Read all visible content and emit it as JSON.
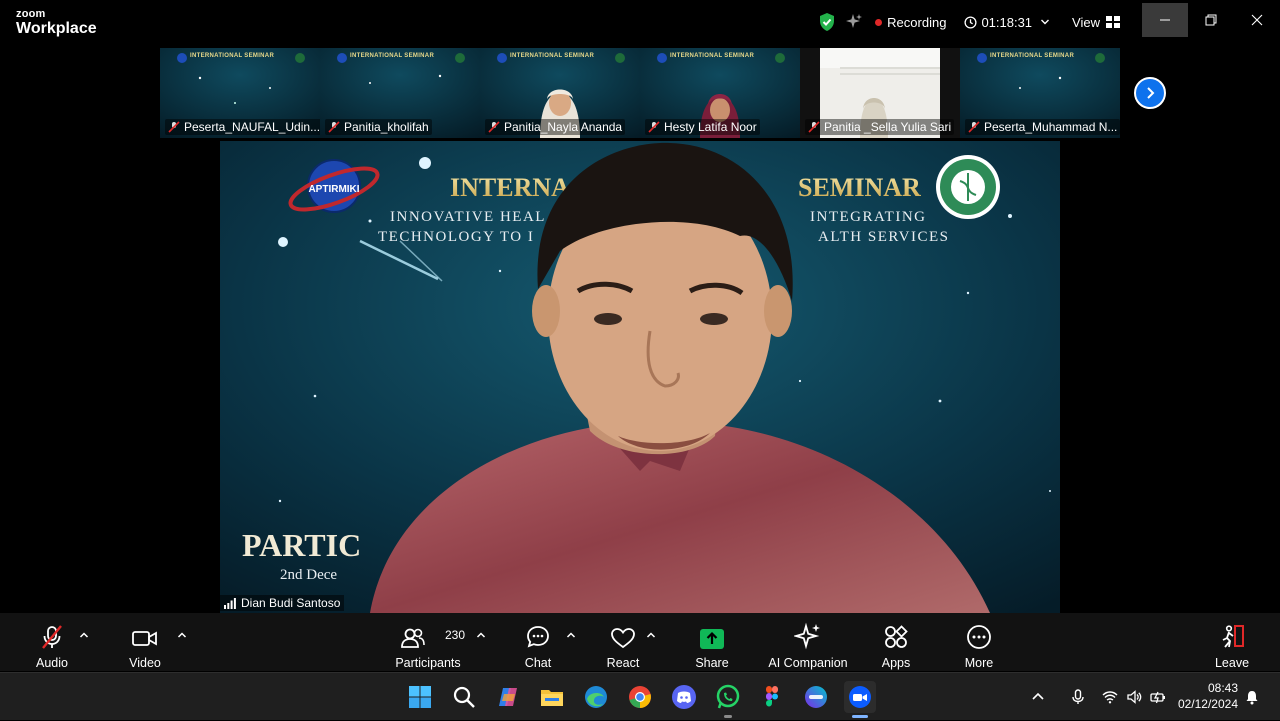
{
  "app": {
    "brand_top": "zoom",
    "brand_bottom": "Workplace"
  },
  "titlebar": {
    "recording_label": "Recording",
    "timer": "01:18:31",
    "view_label": "View"
  },
  "thumbnails": [
    {
      "name": "Peserta_NAUFAL_Udin...",
      "muted": true,
      "has_face": false
    },
    {
      "name": "Panitia_kholifah",
      "muted": true,
      "has_face": false
    },
    {
      "name": "Panitia_Nayla Ananda",
      "muted": true,
      "has_face": true
    },
    {
      "name": "Hesty Latifa Noor",
      "muted": true,
      "has_face": true
    },
    {
      "name": "Panitia _Sella Yulia Sari",
      "muted": true,
      "has_face": true
    },
    {
      "name": "Peserta_Muhammad N...",
      "muted": true,
      "has_face": false
    }
  ],
  "thumb_banner": "INTERNATIONAL SEMINAR",
  "main_video": {
    "speaker_name": "Dian Budi Santoso",
    "banner_title_left": "INTERNA",
    "banner_title_right": "SEMINAR",
    "banner_line1_left": "INNOVATIVE HEAL",
    "banner_line1_right": "INTEGRATING",
    "banner_line2_left": "TECHNOLOGY TO I",
    "banner_line2_right": "ALTH SERVICES",
    "logo_left_text": "APTIRMIKI",
    "lower_text_1": "PARTIC",
    "lower_text_2": "2nd Dece"
  },
  "toolbar": {
    "audio_label": "Audio",
    "video_label": "Video",
    "participants_label": "Participants",
    "participants_count": "230",
    "chat_label": "Chat",
    "react_label": "React",
    "share_label": "Share",
    "ai_label": "AI Companion",
    "apps_label": "Apps",
    "more_label": "More",
    "leave_label": "Leave"
  },
  "taskbar": {
    "time": "08:43",
    "date": "02/12/2024",
    "apps": [
      "windows-start",
      "search",
      "copilot",
      "file-explorer",
      "edge",
      "chrome",
      "discord",
      "whatsapp",
      "figma",
      "canva",
      "zoom"
    ]
  },
  "colors": {
    "accent_blue": "#0e72ed",
    "share_green": "#10b857",
    "recording_red": "#e02828",
    "mute_red": "#e02828",
    "toolbar_bg": "#121212"
  }
}
